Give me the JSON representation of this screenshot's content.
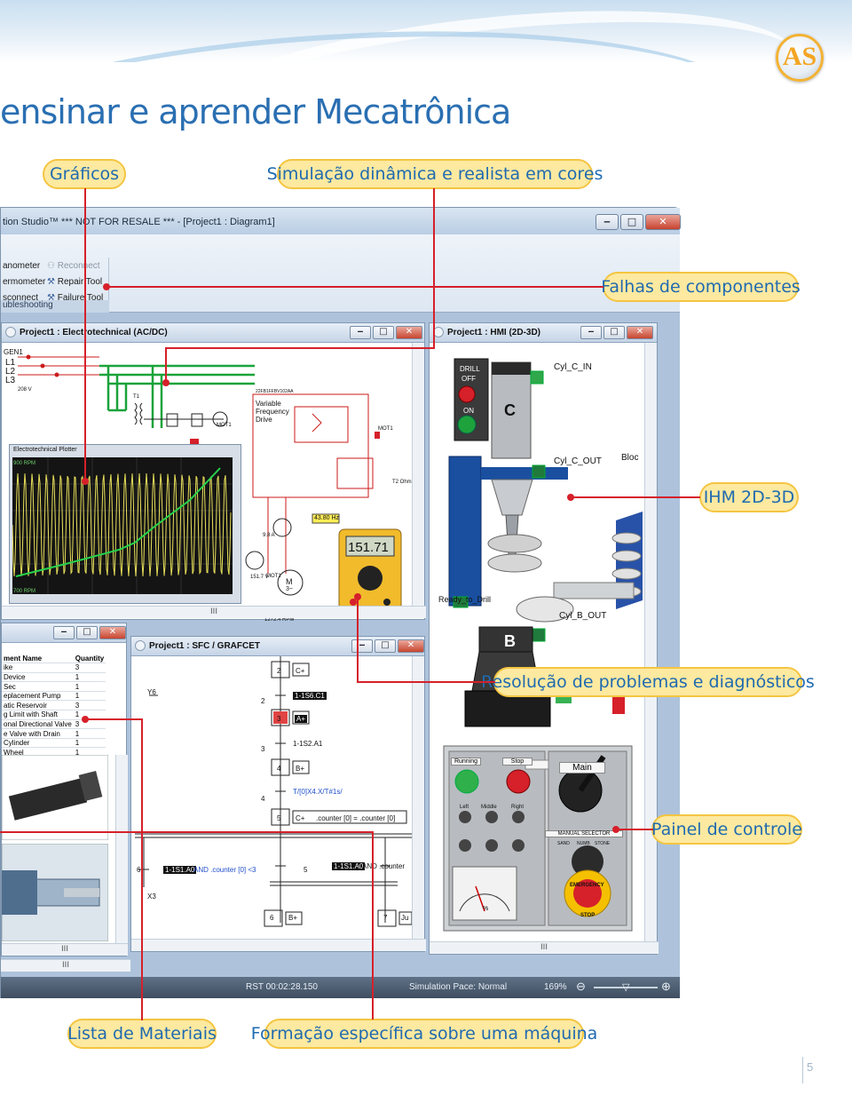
{
  "headline": "ensinar e aprender Mecatrônica",
  "logo_text": "AS",
  "page_number": "5",
  "callouts": {
    "graficos": "Gráficos",
    "simulacao": "Simulação dinâmica e realista em cores",
    "falhas": "Falhas de componentes",
    "ihm": "IHM 2D-3D",
    "resolucao": "Resolução de problemas e diagnósticos",
    "painel": "Painel de controle",
    "lista": "Lista de Materiais",
    "formacao": "Formação específica sobre uma máquina"
  },
  "app": {
    "title": "tion Studio™   *** NOT FOR RESALE ***   - [Project1 : Diagram1]",
    "controls": {
      "min": "‒",
      "max": "□",
      "close": "✕"
    },
    "ribbon": {
      "items": [
        "anometer",
        "ermometer",
        "sconnect",
        "Reconnect",
        "Repair Tool",
        "Failure Tool"
      ],
      "group_label": "ubleshooting"
    },
    "status": {
      "rst": "RST 00:02:28.150",
      "pace": "Simulation Pace: Normal",
      "zoom": "169%"
    }
  },
  "windows": {
    "electro": {
      "title": "Project1 : Electrotechnical (AC/DC)",
      "labels": [
        "GEN1",
        "L1",
        "L2",
        "L3",
        "208 V",
        "T1",
        "MOT1",
        "Variable",
        "Frequency",
        "Drive",
        "MOT1",
        "T2 Ohm",
        "43.80 Hz",
        "151.71",
        "9.8 A",
        "151.7 V",
        "MOT1",
        "1272.4 RPM",
        "M",
        "3~"
      ],
      "plotter_title": "Electrotechnical Plotter",
      "plotter_top": "900 RPM",
      "plotter_bottom": "700 RPM",
      "vfd_code": "22FB1FFBV102AA"
    },
    "hmi": {
      "title": "Project1 : HMI (2D-3D)",
      "labels": {
        "drill": "DRILL",
        "off": "OFF",
        "on": "ON",
        "c": "C",
        "b": "B",
        "cyl_c_in": "Cyl_C_IN",
        "cyl_c_out": "Cyl_C_OUT",
        "bloc": "Bloc",
        "ready": "Ready_to_Drill",
        "cyl_b_out": "Cyl_B_OUT"
      },
      "panel": {
        "running": "Running",
        "stop": "Stop",
        "main": "Main",
        "left": "Left",
        "middle": "Middle",
        "right": "Right",
        "selector": "MANUAL SELECTOR",
        "sand": "SAND",
        "numb": "NUMB",
        "stone": "STONE",
        "percent": "%",
        "emergency": "EMERGENCY",
        "estop": "STOP"
      }
    },
    "bom": {
      "headers": [
        "ment Name",
        "Quantity"
      ],
      "rows": [
        [
          "ike",
          "3"
        ],
        [
          "Device",
          "1"
        ],
        [
          "Sec",
          "1"
        ],
        [
          "eplacement Pump",
          "1"
        ],
        [
          "atic Reservoir",
          "3"
        ],
        [
          "g Limit with Shaft",
          "1"
        ],
        [
          "onal Directional Valve",
          "3"
        ],
        [
          "e Valve with Drain",
          "1"
        ],
        [
          "Cylinder",
          "1"
        ],
        [
          "Wheel",
          "1"
        ]
      ]
    },
    "sfc": {
      "title": "Project1 : SFC / GRAFCET",
      "steps": [
        "2",
        "3",
        "4",
        "5",
        "6",
        "7"
      ],
      "actions": [
        "C+",
        "A+",
        "B+",
        "C+",
        "B+",
        "Ju"
      ],
      "transitions": [
        "1-1S6.C1",
        "1-1S2.A1",
        "T/[0]X4.X/T#1s/",
        "1-1S1.A0",
        "1-1S1.A0"
      ],
      "counter_text": ".counter [0] = .counter [0]",
      "and_counter": "AND .counter [0] <3",
      "and_counter2": "AND .counter",
      "side_labels": [
        "Y6",
        "2",
        "3",
        "4",
        "6",
        "5",
        "X3"
      ]
    }
  }
}
